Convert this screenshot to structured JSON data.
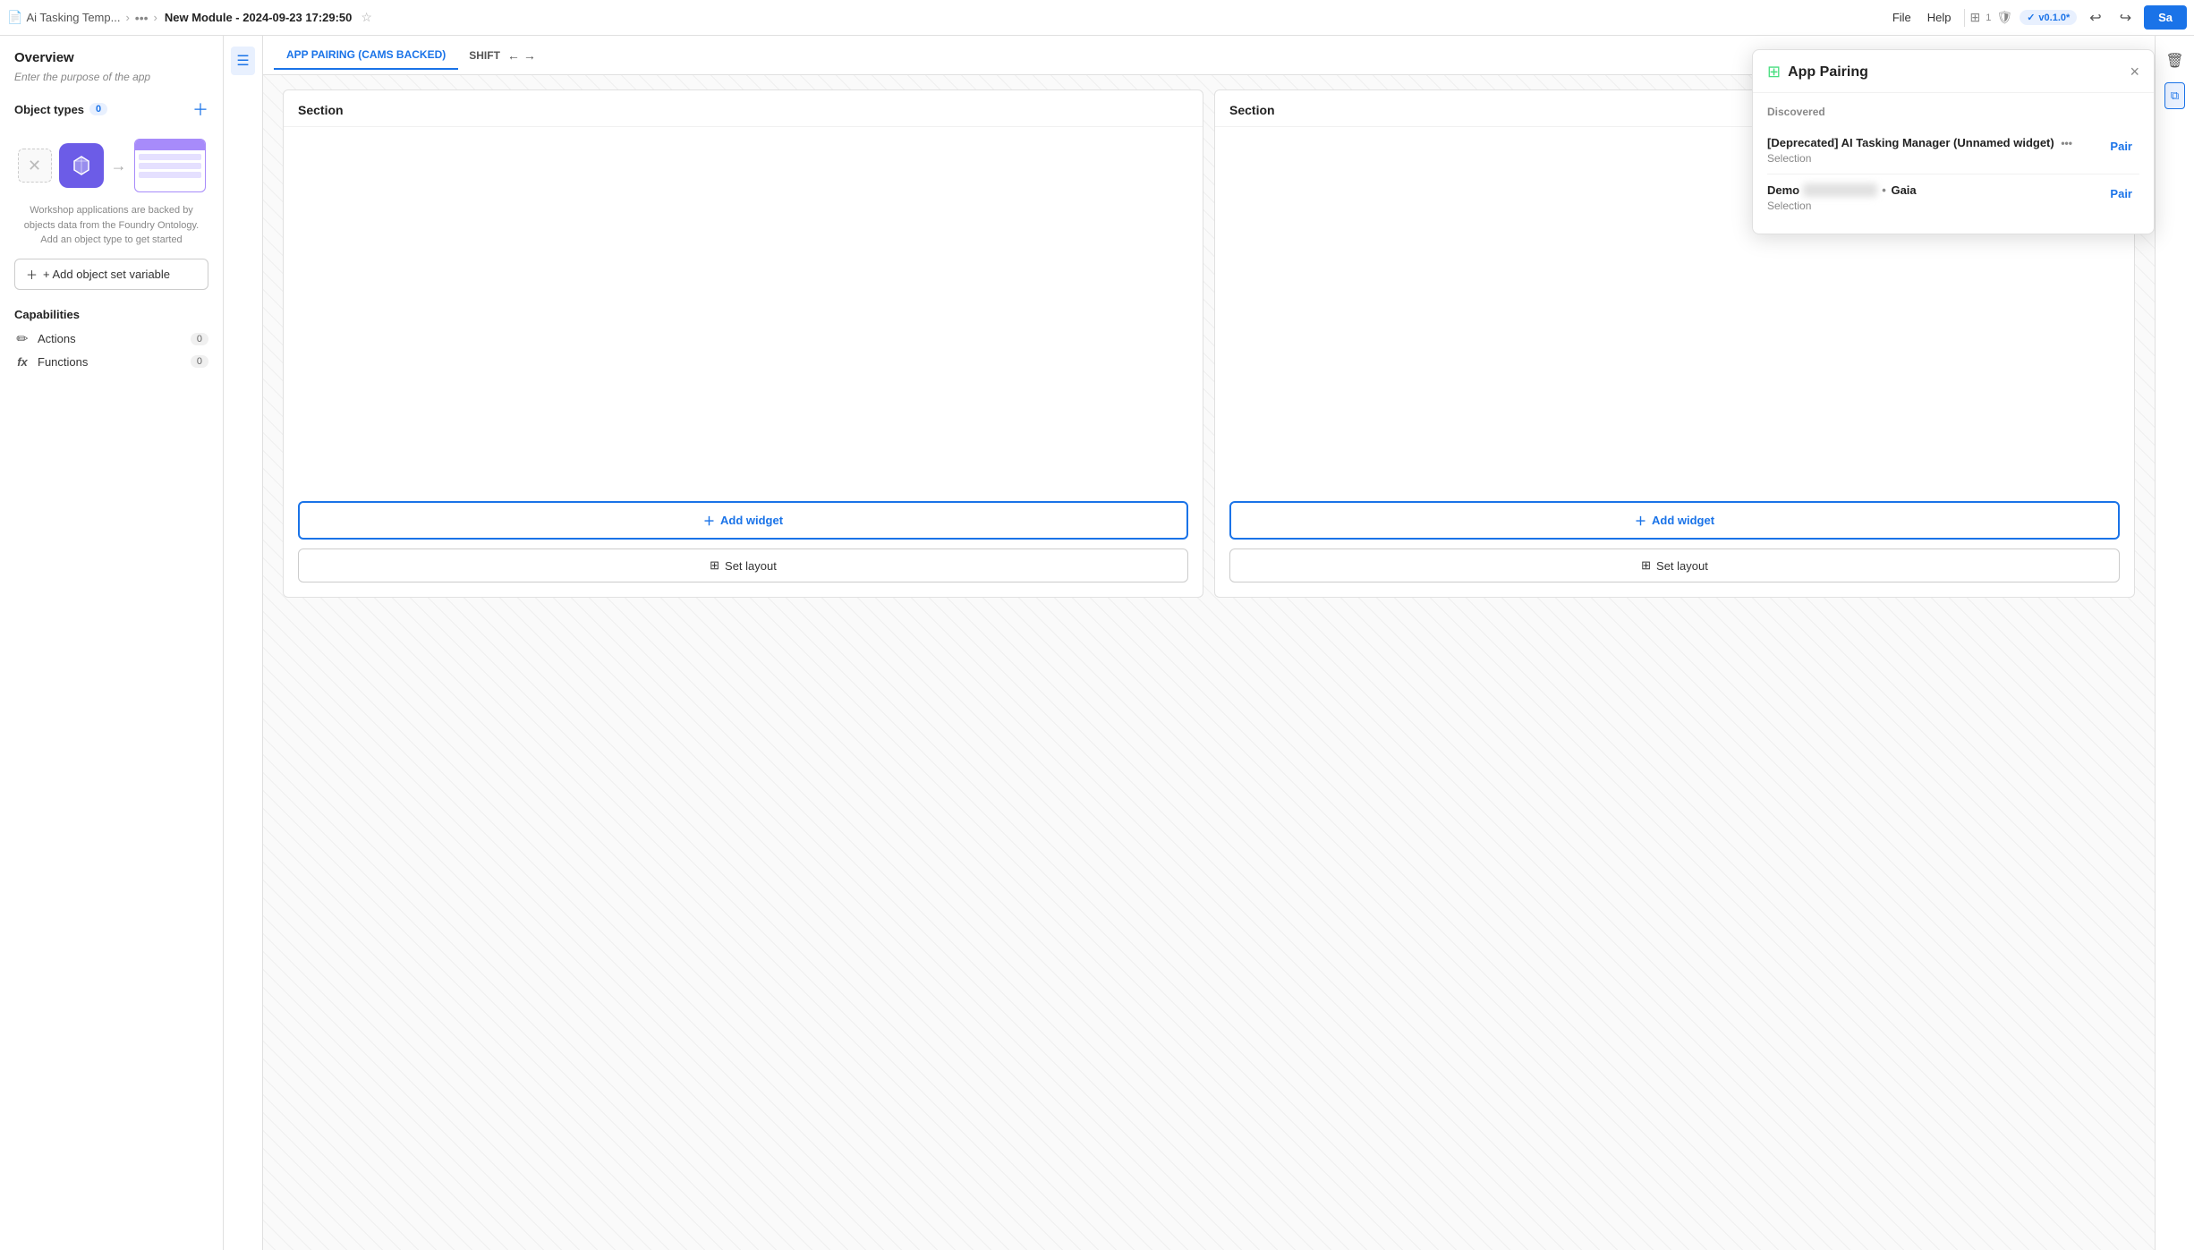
{
  "topbar": {
    "breadcrumb_icon": "📄",
    "breadcrumb_app": "Ai Tasking Temp...",
    "breadcrumb_sep1": "›",
    "breadcrumb_more": "•••",
    "breadcrumb_sep2": "›",
    "title": "New Module - 2024-09-23 17:29:50",
    "star_icon": "☆",
    "file_label": "File",
    "help_label": "Help",
    "grid_icon": "⊞",
    "shield_icon": "🛡",
    "version_label": "v0.1.0*",
    "undo_icon": "↩",
    "redo_icon": "↪",
    "save_label": "Sa"
  },
  "sidebar": {
    "overview_title": "Overview",
    "overview_hint": "Enter the purpose of the app",
    "object_types_label": "Object types",
    "object_types_count": "0",
    "illustration_text": "Workshop applications are backed by objects data from the Foundry Ontology. Add an object type to get started",
    "add_obj_label": "+ Add object set variable",
    "capabilities_title": "Capabilities",
    "actions_label": "Actions",
    "actions_count": "0",
    "functions_label": "Functions",
    "functions_count": "0"
  },
  "tabbar": {
    "tab1_label": "APP PAIRING (CAMS BACKED)",
    "tab2_label": "SHIFT",
    "arrow_left": "←",
    "arrow_right": "→"
  },
  "sections": [
    {
      "header": "Section",
      "add_widget_label": "+ Add widget",
      "set_layout_label": "Set layout"
    },
    {
      "header": "Section",
      "add_widget_label": "+ Add widget",
      "set_layout_label": "Set layout"
    }
  ],
  "popup": {
    "title": "App Pairing",
    "close_icon": "×",
    "section_label": "Discovered",
    "items": [
      {
        "name": "[Deprecated] AI Tasking Manager (Unnamed widget)",
        "name_suffix": "•••",
        "type": "Selection",
        "pair_label": "Pair"
      },
      {
        "name": "Demo",
        "blurred_text": "█████████",
        "dot_sep": "•",
        "org": "Gaia",
        "type": "Selection",
        "pair_label": "Pair"
      }
    ]
  },
  "icons": {
    "actions_icon": "✏",
    "functions_icon": "fx",
    "add_widget_icon": "+",
    "set_layout_icon": "⊞",
    "strip_icon_text": "≡",
    "delete_icon": "🗑",
    "copy_icon": "⧉"
  }
}
